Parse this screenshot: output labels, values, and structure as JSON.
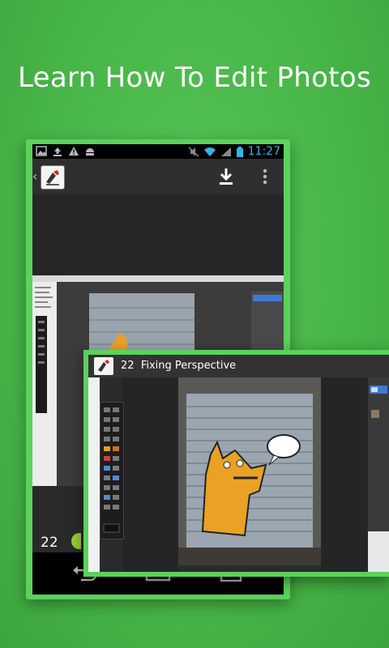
{
  "headline": "Learn How To Edit Photos",
  "status_bar": {
    "time": "11:27",
    "left_icons": [
      "gallery-icon",
      "upload-icon",
      "warning-icon",
      "android-icon"
    ],
    "right_icons": [
      "mute-icon",
      "wifi-icon",
      "signal-icon",
      "battery-icon"
    ],
    "accent_color": "#33b5e5"
  },
  "action_bar": {
    "icons": [
      "app-logo-icon",
      "download-icon",
      "overflow-menu-icon"
    ]
  },
  "lesson_bar": {
    "number": "22"
  },
  "nav_bar": {
    "icons": [
      "back-icon",
      "home-icon",
      "recents-icon"
    ]
  },
  "overlay": {
    "lesson_number": "22",
    "lesson_title": "Fixing Perspective"
  },
  "colors": {
    "background": "#46b446",
    "frame": "#5bd25b",
    "progress": "#9ccd35"
  }
}
